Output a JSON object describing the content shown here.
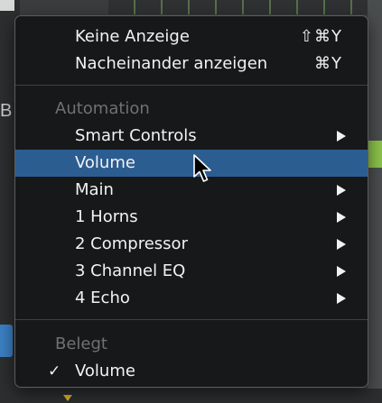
{
  "menu": {
    "items_top": [
      {
        "label": "Keine Anzeige",
        "shortcut": "⇧⌘Y"
      },
      {
        "label": "Nacheinander anzeigen",
        "shortcut": "⌘Y"
      }
    ],
    "automation": {
      "header": "Automation",
      "items": [
        {
          "label": "Smart Controls",
          "submenu": true
        },
        {
          "label": "Volume",
          "submenu": false,
          "highlighted": true
        },
        {
          "label": "Main",
          "submenu": true
        },
        {
          "label": "1 Horns",
          "submenu": true
        },
        {
          "label": "2 Compressor",
          "submenu": true
        },
        {
          "label": "3 Channel EQ",
          "submenu": true
        },
        {
          "label": "4 Echo",
          "submenu": true
        }
      ]
    },
    "belegt": {
      "header": "Belegt",
      "items": [
        {
          "label": "Volume",
          "checked": true,
          "check_mark": "✓"
        }
      ]
    },
    "colors": {
      "highlight": "#2c5d91",
      "background": "#161718",
      "header_text": "#6f7173"
    }
  },
  "background": {
    "left_letter": "B"
  }
}
